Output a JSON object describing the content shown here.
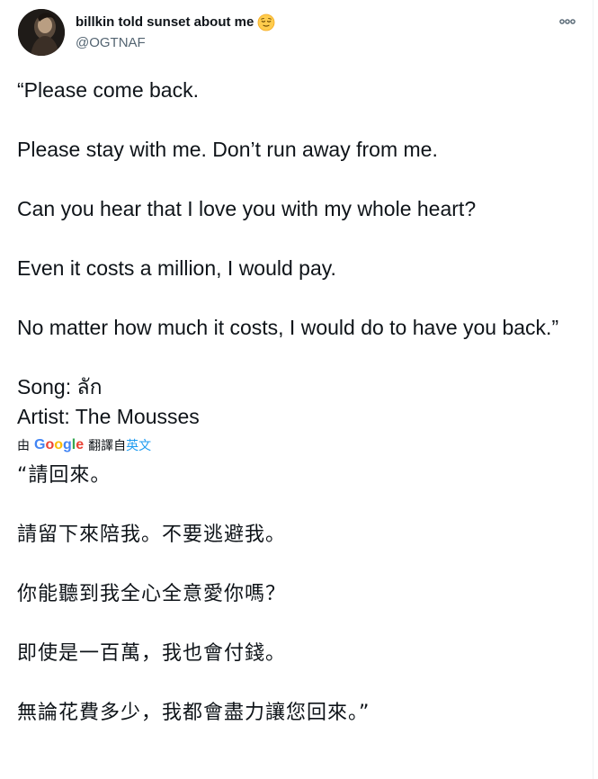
{
  "user": {
    "display_name": "billkin told sunset about me",
    "handle": "@OGTNAF",
    "avatar_icon": "profile-photo",
    "name_emoji": "relieved-face-emoji"
  },
  "more_icon": "more-dots-icon",
  "tweet": {
    "lines": [
      "“Please come back.",
      "Please stay with me. Don’t run away from me.",
      "Can you hear that I love you with my whole heart?",
      "Even it costs a million, I would pay.",
      "No matter how much it costs, I would do to have you back.”"
    ],
    "song": "Song: ลัก",
    "artist": "Artist: The Mousses"
  },
  "translation_bar": {
    "by_label": "由",
    "google_logo": "Google",
    "translated_from": "翻譯自",
    "language": "英文"
  },
  "translation": {
    "lines": [
      "“請回來。",
      "請留下來陪我。不要逃避我。",
      "你能聽到我全心全意愛你嗎？",
      "即使是一百萬，我也會付錢。",
      "無論花費多少，我都會盡力讓您回來。”"
    ]
  },
  "colors": {
    "text": "#0f1419",
    "secondary": "#536471",
    "link": "#1d9bf0"
  }
}
